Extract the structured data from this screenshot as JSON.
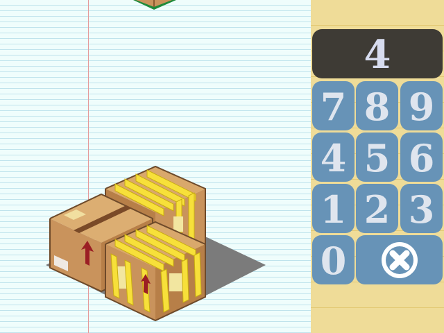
{
  "display": {
    "value": "4"
  },
  "keypad": {
    "keys": [
      "7",
      "8",
      "9",
      "4",
      "5",
      "6",
      "1",
      "2",
      "3",
      "0"
    ],
    "clear_icon": "x-circle-icon"
  },
  "colors": {
    "display_bg": "#3e3b35",
    "key_bg": "#6793b7",
    "key_text": "#dfe5ee",
    "strap": "#f7e03a",
    "cardboard": "#c9935c"
  }
}
